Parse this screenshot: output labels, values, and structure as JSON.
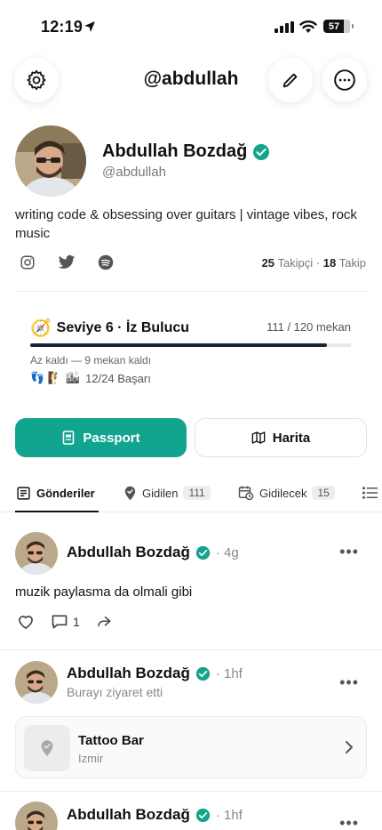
{
  "status_bar": {
    "time": "12:19",
    "battery": "57"
  },
  "header": {
    "title": "@abdullah"
  },
  "profile": {
    "name": "Abdullah Bozdağ",
    "handle": "@abdullah",
    "bio": "writing code & obsessing over guitars | vintage vibes, rock music",
    "followers_count": "25",
    "followers_label": "Takipçi",
    "following_count": "18",
    "following_label": "Takip",
    "separator": "·"
  },
  "level": {
    "emoji": "🧭",
    "title": "Seviye 6 · İz Bulucu",
    "count": "111 / 120 mekan",
    "progress": 0.925,
    "remaining": "Az kaldı — 9 mekan kaldı",
    "badges_emoji": "👣 🧗 🏙",
    "badges_text": "12/24 Başarı"
  },
  "buttons": {
    "passport": "Passport",
    "map": "Harita"
  },
  "tabs": [
    {
      "label": "Gönderiler",
      "count": ""
    },
    {
      "label": "Gidilen",
      "count": "111"
    },
    {
      "label": "Gidilecek",
      "count": "15"
    }
  ],
  "posts": [
    {
      "author": "Abdullah Bozdağ",
      "time": "· 4g",
      "text": "muzik paylasma da olmali gibi",
      "comments": "1"
    },
    {
      "author": "Abdullah Bozdağ",
      "time": "· 1hf",
      "subtitle": "Burayı ziyaret etti",
      "place_name": "Tattoo Bar",
      "place_city": "Izmir"
    },
    {
      "author": "Abdullah Bozdağ",
      "time": "· 1hf"
    }
  ],
  "more_glyph": "•••",
  "colors": {
    "accent": "#11a48f",
    "verified": "#14a38b",
    "progress": "#1a2438"
  }
}
